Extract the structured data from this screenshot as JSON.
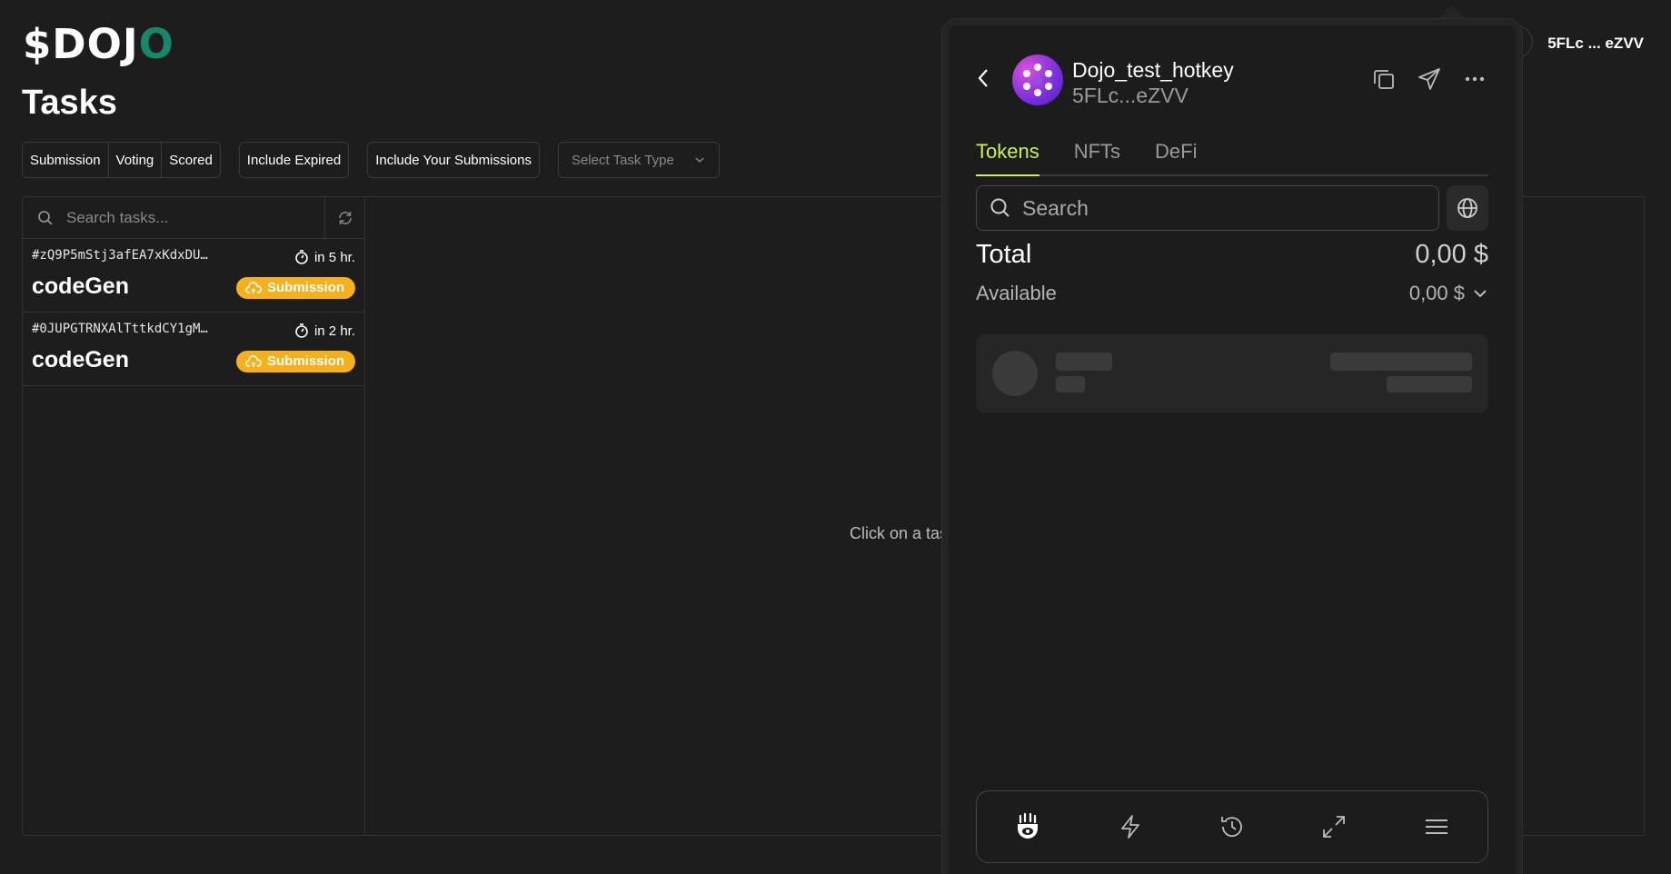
{
  "app": {
    "logo_main": "$DOJ",
    "logo_accent": "O",
    "page_title": "Tasks",
    "connected_address": "5FLc ... eZVV"
  },
  "filters": {
    "segments": [
      "Submission",
      "Voting",
      "Scored"
    ],
    "include_expired": "Include Expired",
    "include_submissions": "Include Your Submissions",
    "task_type_placeholder": "Select Task Type"
  },
  "task_list": {
    "search_placeholder": "Search tasks...",
    "tasks": [
      {
        "id": "#zQ9P5mStj3afEA7xKdxDU…",
        "time": "in 5 hr.",
        "name": "codeGen",
        "badge": "Submission"
      },
      {
        "id": "#0JUPGTRNXAlTttkdCY1gM…",
        "time": "in 2 hr.",
        "name": "codeGen",
        "badge": "Submission"
      }
    ],
    "empty_detail_text": "Click on a tas"
  },
  "wallet": {
    "account_name": "Dojo_test_hotkey",
    "account_address": "5FLc...eZVV",
    "tabs": [
      "Tokens",
      "NFTs",
      "DeFi"
    ],
    "active_tab": "Tokens",
    "search_placeholder": "Search",
    "total_label": "Total",
    "total_value": "0,00 $",
    "available_label": "Available",
    "available_value": "0,00 $",
    "header_icons": [
      "copy-icon",
      "send-icon",
      "more-icon"
    ],
    "dock_icons": [
      "mascot-icon",
      "lightning-icon",
      "history-icon",
      "expand-icon",
      "menu-icon"
    ],
    "accent_color": "#c7f25b"
  },
  "colors": {
    "background": "#1d1d1d",
    "logo_accent": "#17866b",
    "badge": "#f5b01c"
  }
}
